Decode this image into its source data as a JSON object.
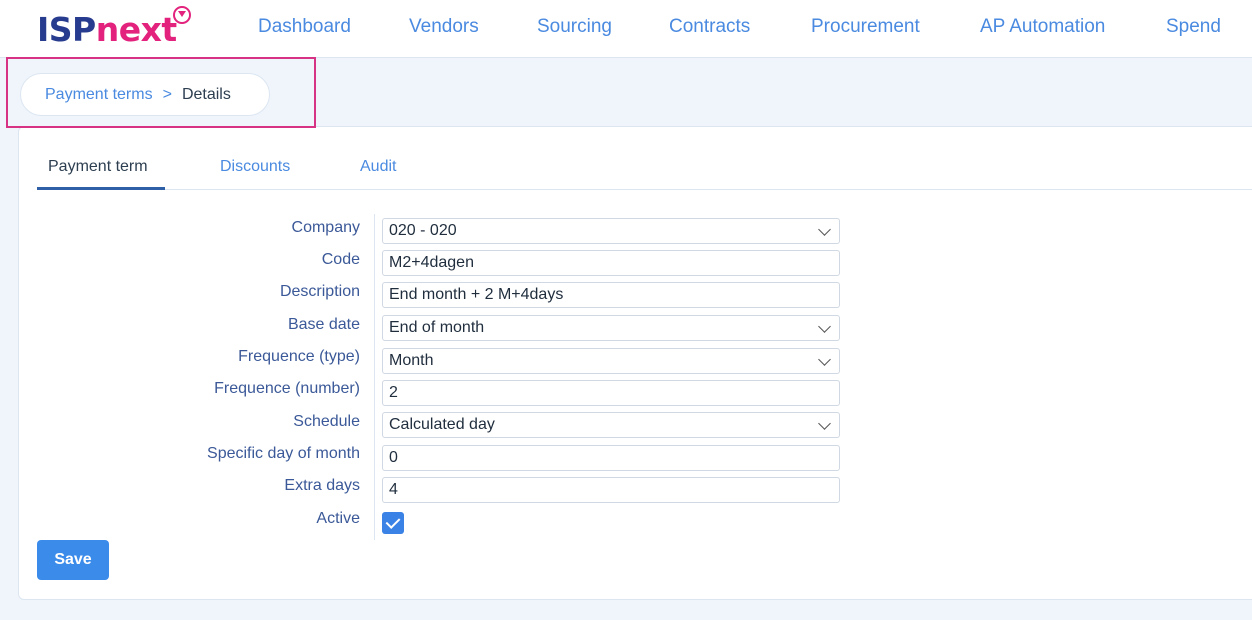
{
  "brand": {
    "logo_part1": "ISP",
    "logo_part2": "next",
    "accent_blue": "#273c8f",
    "accent_pink": "#e2227c"
  },
  "nav": {
    "items": [
      "Dashboard",
      "Vendors",
      "Sourcing",
      "Contracts",
      "Procurement",
      "AP Automation",
      "Spend"
    ]
  },
  "breadcrumb": {
    "parent": "Payment terms",
    "separator": ">",
    "current": "Details"
  },
  "tabs": [
    "Payment term",
    "Discounts",
    "Audit"
  ],
  "form": {
    "company": {
      "label": "Company",
      "value": "020 - 020"
    },
    "code": {
      "label": "Code",
      "value": "M2+4dagen"
    },
    "description": {
      "label": "Description",
      "value": "End month + 2 M+4days"
    },
    "base_date": {
      "label": "Base date",
      "value": "End of month"
    },
    "frequence_type": {
      "label": "Frequence (type)",
      "value": "Month"
    },
    "frequence_number": {
      "label": "Frequence (number)",
      "value": "2"
    },
    "schedule": {
      "label": "Schedule",
      "value": "Calculated day"
    },
    "specific_day": {
      "label": "Specific day of month",
      "value": "0"
    },
    "extra_days": {
      "label": "Extra days",
      "value": "4"
    },
    "active": {
      "label": "Active",
      "checked": true
    }
  },
  "actions": {
    "save_label": "Save"
  }
}
